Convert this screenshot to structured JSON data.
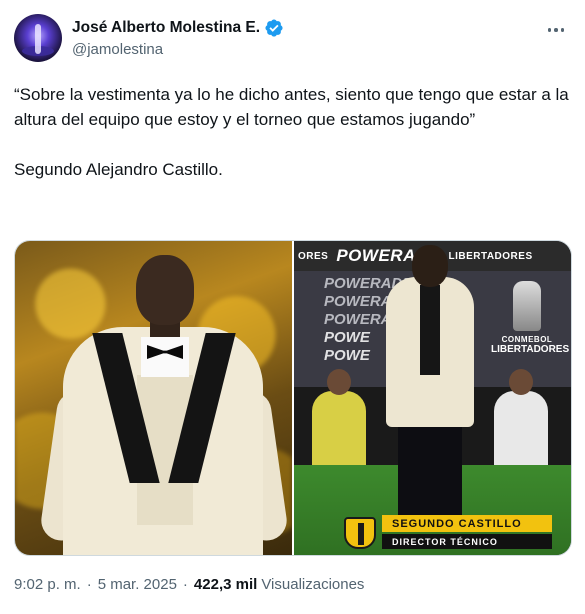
{
  "author": {
    "display_name": "José Alberto Molestina E.",
    "handle": "@jamolestina",
    "verified": true
  },
  "tweet": {
    "quote": "“Sobre la vestimenta ya lo he dicho antes, siento que tengo que estar a la altura del equipo que estoy y el torneo que estamos jugando”",
    "attribution": "Segundo Alejandro Castillo."
  },
  "media": {
    "right_photo": {
      "ad_band": [
        "ORES",
        "POWERADE",
        "LIBERTADORES"
      ],
      "ad_stack": [
        "POWERADE",
        "POWERADE",
        "POWERADE",
        "POWE",
        "POWE"
      ],
      "conmebol_small": "CONMEBOL",
      "conmebol_big": "LIBERTADORES",
      "lower_third_name": "SEGUNDO CASTILLO",
      "lower_third_role": "DIRECTOR TÉCNICO"
    }
  },
  "meta": {
    "time": "9:02 p. m.",
    "separator": "·",
    "date": "5 mar. 2025",
    "views_count": "422,3 mil",
    "views_label": "Visualizaciones"
  },
  "colors": {
    "text_primary": "#0f1419",
    "text_secondary": "#536471",
    "verified_blue": "#1d9bf0",
    "border": "#cfd9de"
  },
  "icons": [
    "verified-badge-icon",
    "more-options-icon"
  ]
}
